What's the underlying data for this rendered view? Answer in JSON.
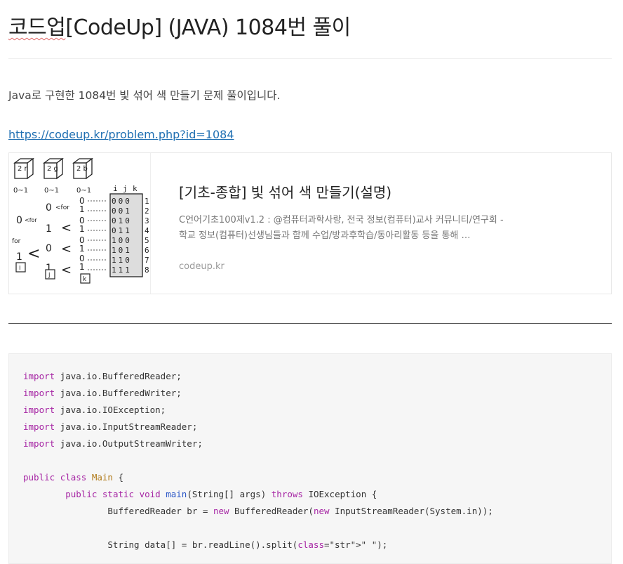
{
  "post": {
    "title_underlined": "코드업",
    "title_rest": "[CodeUp] (JAVA) 1084번 풀이",
    "intro": "Java로 구현한 1084번 빛 섞어 색 만들기 문제 풀이입니다.",
    "link": "https://codeup.kr/problem.php?id=1084"
  },
  "card": {
    "title": "[기초-종합] 빛 섞어 색 만들기(설명)",
    "description": "C언어기초100제v1.2 : @컴퓨터과학사랑, 전국 정보(컴퓨터)교사 커뮤니티/연구회 - 학교 정보(컴퓨터)선생님들과 함께 수업/방과후학습/동아리활동 등을 통해 …",
    "domain": "codeup.kr",
    "thumb": {
      "boxes": [
        "2 r",
        "2 g",
        "2 b"
      ],
      "box_ranges": [
        "0~1",
        "0~1",
        "0~1"
      ],
      "table_header": [
        "i",
        "j",
        "k"
      ],
      "table_rows": [
        "000",
        "001",
        "010",
        "011",
        "100",
        "101",
        "110",
        "111"
      ],
      "row_numbers": [
        "1",
        "2",
        "3",
        "4",
        "5",
        "6",
        "7",
        "8"
      ],
      "bottom_labels": [
        "i",
        "j",
        "k"
      ]
    }
  },
  "code": {
    "lines": [
      "import java.io.BufferedReader;",
      "import java.io.BufferedWriter;",
      "import java.io.IOException;",
      "import java.io.InputStreamReader;",
      "import java.io.OutputStreamWriter;",
      "",
      "public class Main {",
      "        public static void main(String[] args) throws IOException {",
      "                BufferedReader br = new BufferedReader(new InputStreamReader(System.in));",
      "",
      "                String data[] = br.readLine().split(\" \");"
    ]
  }
}
